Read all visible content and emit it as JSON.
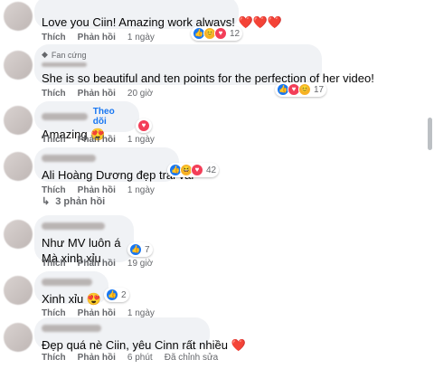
{
  "comments": [
    {
      "text": "Love you Ciin! Amazing work always! ❤️❤️❤️",
      "reply": "Thích",
      "respond": "Phản hồi",
      "time": "1 ngày",
      "count": "12"
    },
    {
      "badge": "Fan cứng",
      "text": "She is so beautiful and ten points for the perfection of her video!",
      "reply": "Thích",
      "respond": "Phản hồi",
      "time": "20 giờ",
      "count": "17"
    },
    {
      "follow": "Theo dõi",
      "text": "Amazing 😍",
      "reply": "Thích",
      "respond": "Phản hồi",
      "time": "1 ngày",
      "count": ""
    },
    {
      "text": "Ali Hoàng Dương đẹp trai vãi",
      "reply": "Thích",
      "respond": "Phản hồi",
      "time": "1 ngày",
      "count": "42"
    },
    {
      "text1": "Như MV luôn á",
      "text2": "Mà xinh xỉu",
      "reply": "Thích",
      "respond": "Phản hồi",
      "time": "19 giờ",
      "count": "7"
    },
    {
      "text": "Xinh xỉu 😍",
      "reply": "Thích",
      "respond": "Phản hồi",
      "time": "1 ngày",
      "count": "2"
    },
    {
      "text": "Đẹp quá nè Ciin, yêu Cinn rất nhiều ❤️",
      "reply": "Thích",
      "respond": "Phản hồi",
      "time": "6 phút",
      "edited": "Đã chỉnh sửa"
    }
  ],
  "replies_toggle": "3 phản hồi",
  "colors": {
    "like": "#1877f2",
    "love": "#f33e58",
    "bubble": "#f0f2f5",
    "meta": "#65676b"
  }
}
